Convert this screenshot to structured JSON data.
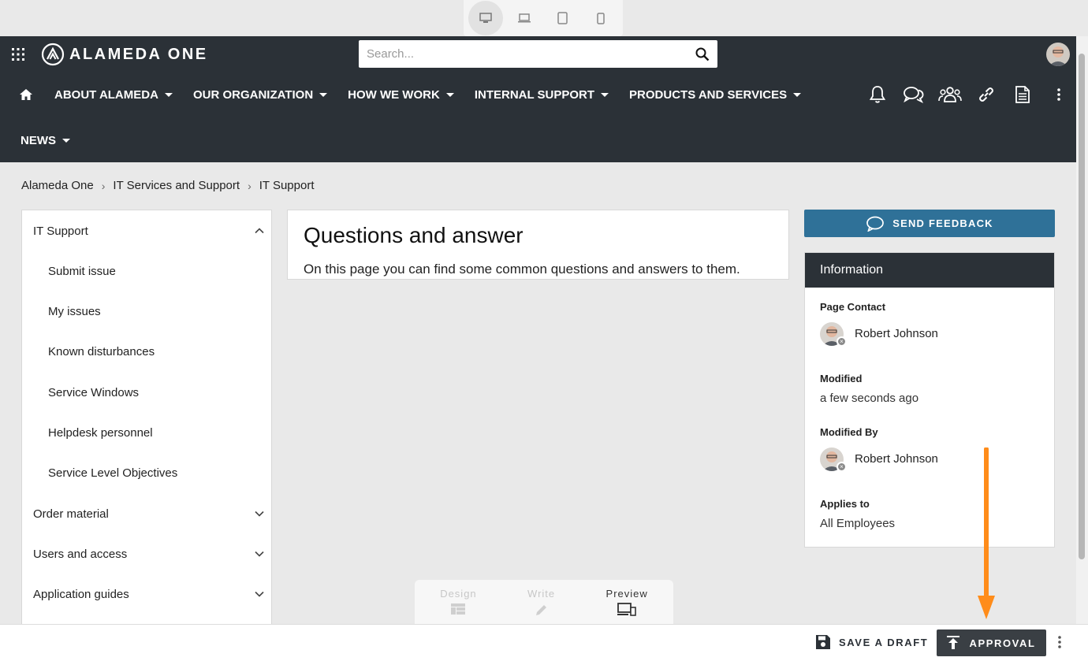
{
  "device_switcher": {
    "items": [
      {
        "name": "desktop-icon",
        "active": true
      },
      {
        "name": "laptop-icon",
        "active": false
      },
      {
        "name": "tablet-icon",
        "active": false
      },
      {
        "name": "phone-icon",
        "active": false
      }
    ]
  },
  "header": {
    "logo_text": "ALAMEDA ONE",
    "search_placeholder": "Search...",
    "nav": [
      {
        "label": "ABOUT ALAMEDA"
      },
      {
        "label": "OUR ORGANIZATION"
      },
      {
        "label": "HOW WE WORK"
      },
      {
        "label": "INTERNAL SUPPORT"
      },
      {
        "label": "PRODUCTS AND SERVICES"
      }
    ],
    "nav_row2": {
      "label": "NEWS"
    },
    "tool_icons": [
      "bell-icon",
      "chat-icon",
      "people-icon",
      "link-icon",
      "document-icon",
      "more-vertical-icon"
    ],
    "colors": {
      "bar": "#2b3137",
      "accent": "#2f7198"
    }
  },
  "breadcrumb": [
    "Alameda One",
    "IT Services and Support",
    "IT Support"
  ],
  "left_nav": {
    "items": [
      {
        "label": "IT Support",
        "expanded": true
      },
      {
        "label": "Submit issue"
      },
      {
        "label": "My issues"
      },
      {
        "label": "Known disturbances"
      },
      {
        "label": "Service Windows"
      },
      {
        "label": "Helpdesk personnel"
      },
      {
        "label": "Service Level Objectives"
      },
      {
        "label": "Order material",
        "expanded": false
      },
      {
        "label": "Users and access",
        "expanded": false
      },
      {
        "label": "Application guides",
        "expanded": false
      }
    ]
  },
  "main": {
    "title": "Questions and answer",
    "description": "On this page you can find some common questions and answers to them."
  },
  "right_panel": {
    "feedback_label": "SEND FEEDBACK",
    "info_title": "Information",
    "page_contact_label": "Page Contact",
    "page_contact_name": "Robert Johnson",
    "modified_label": "Modified",
    "modified_value": "a few seconds ago",
    "modified_by_label": "Modified By",
    "modified_by_name": "Robert Johnson",
    "applies_to_label": "Applies to",
    "applies_to_value": "All Employees"
  },
  "editor_modes": [
    {
      "label": "Design",
      "state": "disabled"
    },
    {
      "label": "Write",
      "state": "disabled"
    },
    {
      "label": "Preview",
      "state": "active"
    }
  ],
  "bottom_bar": {
    "save_draft_label": "SAVE A DRAFT",
    "approval_label": "APPROVAL",
    "annotation_color": "#ff8c1a"
  }
}
